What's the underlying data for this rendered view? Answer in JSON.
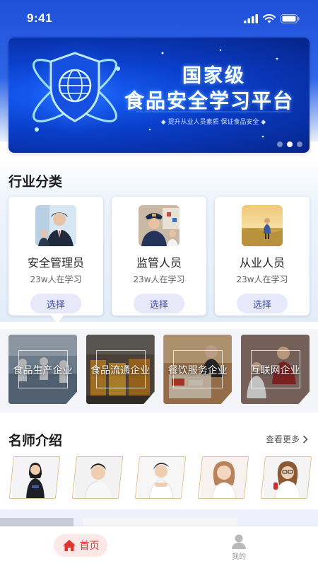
{
  "status_bar": {
    "time": "9:41"
  },
  "banner": {
    "title_line1": "国家级",
    "title_line2": "食品安全学习平台",
    "subtitle": "◆ 提升从业人员素质 保证食品安全 ◆",
    "page_count": 3,
    "active_page": 2
  },
  "industry": {
    "title": "行业分类",
    "categories": [
      {
        "name": "安全管理员",
        "learners": "23w人在学习",
        "button": "选择"
      },
      {
        "name": "监管人员",
        "learners": "23w人在学习",
        "button": "选择"
      },
      {
        "name": "从业人员",
        "learners": "23w人在学习",
        "button": "选择"
      }
    ]
  },
  "enterprises": [
    {
      "label": "食品生产企业"
    },
    {
      "label": "食品流通企业"
    },
    {
      "label": "餐饮服务企业"
    },
    {
      "label": "互联网企业"
    }
  ],
  "teachers": {
    "title": "名师介绍",
    "more": "查看更多",
    "count": 5
  },
  "tabbar": {
    "home": "首页",
    "mine": "我的",
    "active_color": "#e2332f"
  },
  "colors": {
    "brand_blue": "#1e4fd8",
    "button_bg": "#e7e9fb",
    "button_text": "#3c4aa8"
  }
}
